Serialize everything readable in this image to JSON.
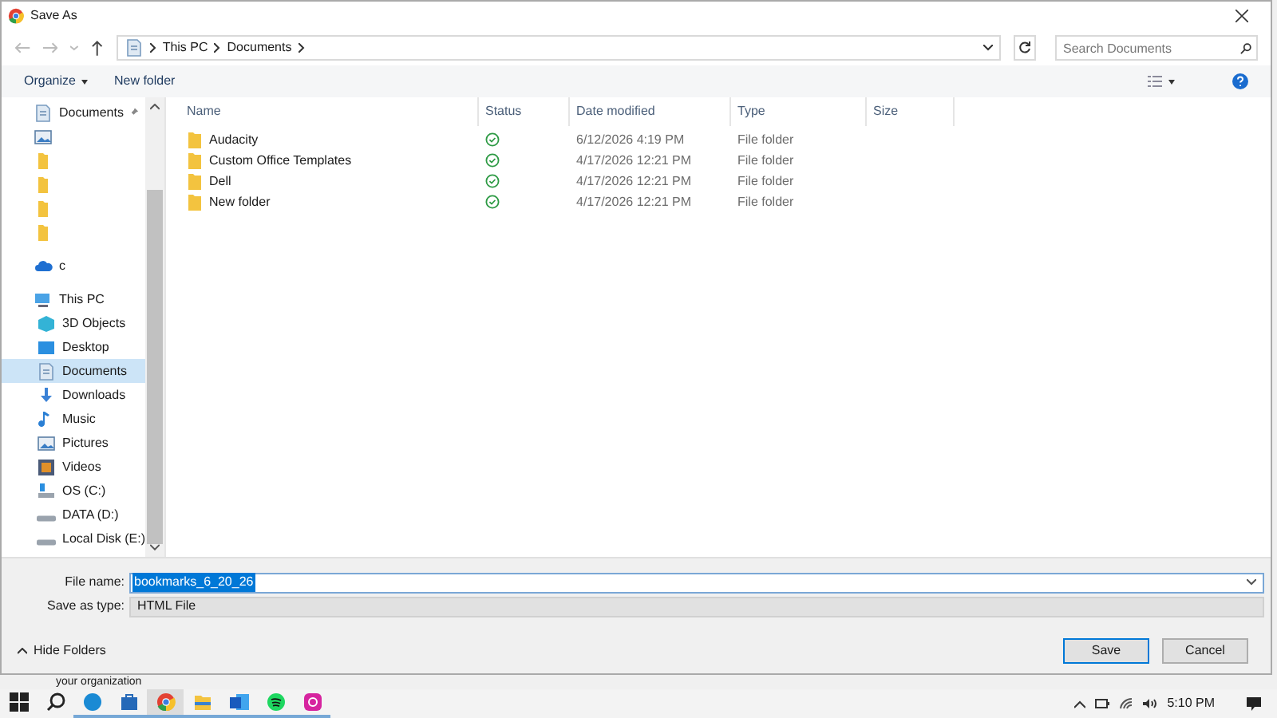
{
  "window": {
    "title": "Save As"
  },
  "address": {
    "path": [
      "This PC",
      "Documents"
    ]
  },
  "search": {
    "placeholder": "Search Documents"
  },
  "toolbar": {
    "organize": "Organize",
    "new_folder": "New folder"
  },
  "sidebar": {
    "items": [
      {
        "kind": "documents",
        "label": "Documents",
        "pinned": true,
        "selected": false
      },
      {
        "kind": "pictures",
        "selected": false
      },
      {
        "kind": "folder",
        "selected": false
      },
      {
        "kind": "folder",
        "selected": false
      },
      {
        "kind": "folder",
        "selected": false
      },
      {
        "kind": "folder",
        "selected": false
      },
      {
        "kind": "cloud",
        "label": "c",
        "selected": false
      },
      {
        "kind": "pc",
        "label": "This PC",
        "selected": false,
        "children": [
          {
            "kind": "cube",
            "label": "3D Objects",
            "selected": false
          },
          {
            "kind": "desktop",
            "label": "Desktop",
            "selected": false
          },
          {
            "kind": "documents",
            "label": "Documents",
            "selected": true
          },
          {
            "kind": "downloads",
            "label": "Downloads",
            "selected": false
          },
          {
            "kind": "music",
            "label": "Music",
            "selected": false
          },
          {
            "kind": "pictures",
            "label": "Pictures",
            "selected": false
          },
          {
            "kind": "videos",
            "label": "Videos",
            "selected": false
          },
          {
            "kind": "osdrive",
            "label": "OS (C:)",
            "selected": false
          },
          {
            "kind": "drive",
            "label": "DATA (D:)",
            "selected": false
          },
          {
            "kind": "drive",
            "label": "Local Disk (E:)",
            "selected": false
          }
        ]
      }
    ]
  },
  "table": {
    "columns": [
      "Name",
      "Status",
      "Date modified",
      "Type",
      "Size"
    ],
    "rows": [
      {
        "name": "Audacity",
        "date": "6/12/2026 4:19 PM",
        "type": "File folder"
      },
      {
        "name": "Custom Office Templates",
        "date": "4/17/2026 12:21 PM",
        "type": "File folder"
      },
      {
        "name": "Dell",
        "date": "4/17/2026 12:21 PM",
        "type": "File folder"
      },
      {
        "name": "New folder",
        "date": "4/17/2026 12:21 PM",
        "type": "File folder"
      }
    ]
  },
  "form": {
    "file_name_label": "File name:",
    "file_name": "bookmarks_6_20_26",
    "type_label": "Save as type:",
    "type": "HTML File"
  },
  "hide_folders": "Hide Folders",
  "buttons": [
    "Save",
    "Cancel"
  ],
  "background_text": "your organization",
  "taskbar": {
    "apps": [
      {
        "kind": "start",
        "running": false,
        "selected": false
      },
      {
        "kind": "search",
        "running": false,
        "selected": false
      },
      {
        "kind": "edge",
        "running": true,
        "selected": false
      },
      {
        "kind": "store",
        "running": true,
        "selected": false
      },
      {
        "kind": "chrome",
        "running": true,
        "selected": true
      },
      {
        "kind": "explorer",
        "running": true,
        "selected": false
      },
      {
        "kind": "word",
        "running": true,
        "selected": false
      },
      {
        "kind": "spotify",
        "running": true,
        "selected": false
      },
      {
        "kind": "instagram",
        "running": true,
        "selected": false
      }
    ],
    "time": "5:10 PM"
  }
}
